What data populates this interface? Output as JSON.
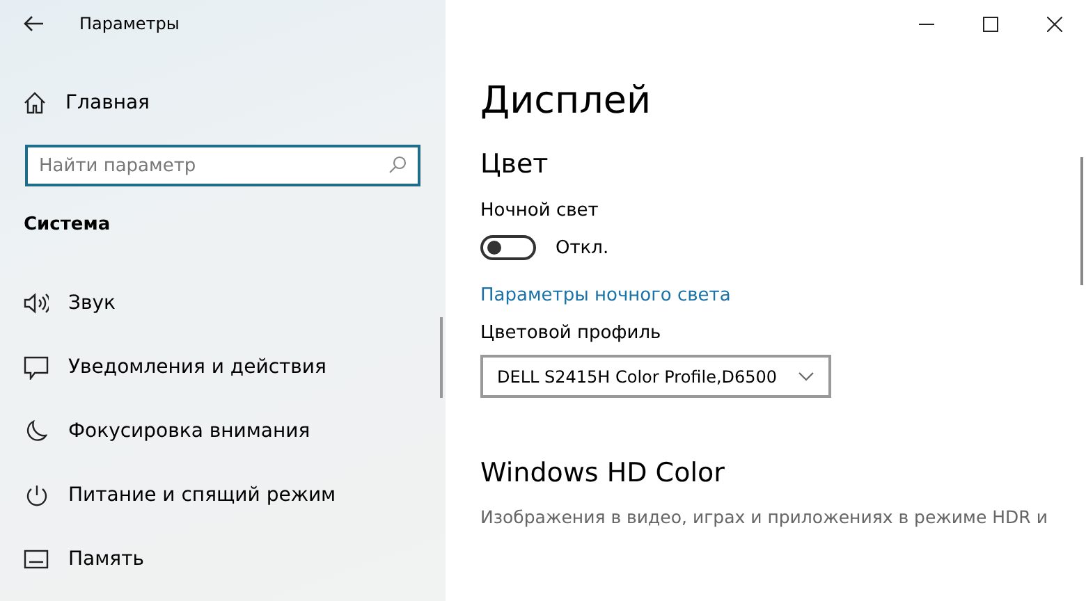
{
  "window": {
    "title": "Параметры"
  },
  "sidebar": {
    "home": "Главная",
    "search": {
      "placeholder": "Найти параметр"
    },
    "section": "Система",
    "items": [
      {
        "label": "Звук"
      },
      {
        "label": "Уведомления и действия"
      },
      {
        "label": "Фокусировка внимания"
      },
      {
        "label": "Питание и спящий режим"
      },
      {
        "label": "Память"
      }
    ]
  },
  "content": {
    "title": "Дисплей",
    "section": "Цвет",
    "night_light": {
      "label": "Ночной свет",
      "on": false,
      "state_text": "Откл."
    },
    "link": "Параметры ночного света",
    "color_profile": {
      "label": "Цветовой профиль",
      "value": "DELL S2415H Color Profile,D6500"
    },
    "hd_color": {
      "title": "Windows HD Color",
      "description": "Изображения в видео, играх и приложениях в режиме HDR и"
    }
  }
}
